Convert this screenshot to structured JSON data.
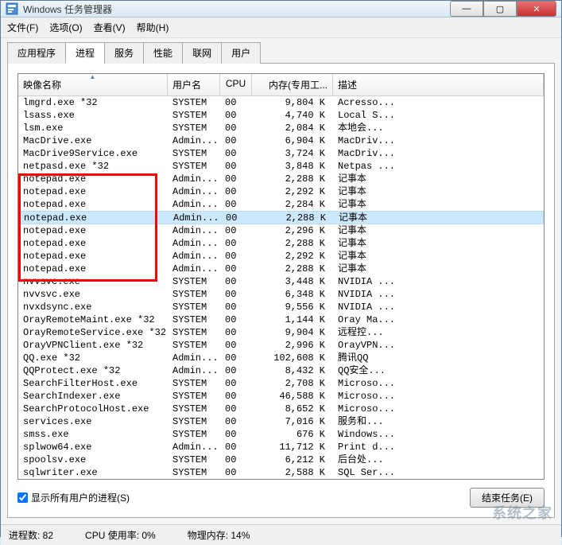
{
  "window": {
    "title": "Windows 任务管理器"
  },
  "menu": {
    "file": "文件(F)",
    "options": "选项(O)",
    "view": "查看(V)",
    "help": "帮助(H)"
  },
  "tabs": [
    "应用程序",
    "进程",
    "服务",
    "性能",
    "联网",
    "用户"
  ],
  "active_tab_index": 1,
  "columns": {
    "image": "映像名称",
    "user": "用户名",
    "cpu": "CPU",
    "mem": "内存(专用工...",
    "desc": "描述"
  },
  "rows": [
    {
      "image": "lmgrd.exe *32",
      "user": "SYSTEM",
      "cpu": "00",
      "mem": "9,804 K",
      "desc": "Acresso..."
    },
    {
      "image": "lsass.exe",
      "user": "SYSTEM",
      "cpu": "00",
      "mem": "4,740 K",
      "desc": "Local S..."
    },
    {
      "image": "lsm.exe",
      "user": "SYSTEM",
      "cpu": "00",
      "mem": "2,084 K",
      "desc": "本地会..."
    },
    {
      "image": "MacDrive.exe",
      "user": "Admin...",
      "cpu": "00",
      "mem": "6,904 K",
      "desc": "MacDriv..."
    },
    {
      "image": "MacDrive9Service.exe",
      "user": "SYSTEM",
      "cpu": "00",
      "mem": "3,724 K",
      "desc": "MacDriv..."
    },
    {
      "image": "netpasd.exe *32",
      "user": "SYSTEM",
      "cpu": "00",
      "mem": "3,848 K",
      "desc": "Netpas ..."
    },
    {
      "image": "notepad.exe",
      "user": "Admin...",
      "cpu": "00",
      "mem": "2,288 K",
      "desc": "记事本"
    },
    {
      "image": "notepad.exe",
      "user": "Admin...",
      "cpu": "00",
      "mem": "2,292 K",
      "desc": "记事本"
    },
    {
      "image": "notepad.exe",
      "user": "Admin...",
      "cpu": "00",
      "mem": "2,284 K",
      "desc": "记事本"
    },
    {
      "image": "notepad.exe",
      "user": "Admin...",
      "cpu": "00",
      "mem": "2,288 K",
      "desc": "记事本",
      "selected": true
    },
    {
      "image": "notepad.exe",
      "user": "Admin...",
      "cpu": "00",
      "mem": "2,296 K",
      "desc": "记事本"
    },
    {
      "image": "notepad.exe",
      "user": "Admin...",
      "cpu": "00",
      "mem": "2,288 K",
      "desc": "记事本"
    },
    {
      "image": "notepad.exe",
      "user": "Admin...",
      "cpu": "00",
      "mem": "2,292 K",
      "desc": "记事本"
    },
    {
      "image": "notepad.exe",
      "user": "Admin...",
      "cpu": "00",
      "mem": "2,288 K",
      "desc": "记事本"
    },
    {
      "image": "nvvsvc.exe",
      "user": "SYSTEM",
      "cpu": "00",
      "mem": "3,448 K",
      "desc": "NVIDIA ..."
    },
    {
      "image": "nvvsvc.exe",
      "user": "SYSTEM",
      "cpu": "00",
      "mem": "6,348 K",
      "desc": "NVIDIA ..."
    },
    {
      "image": "nvxdsync.exe",
      "user": "SYSTEM",
      "cpu": "00",
      "mem": "9,556 K",
      "desc": "NVIDIA ..."
    },
    {
      "image": "OrayRemoteMaint.exe *32",
      "user": "SYSTEM",
      "cpu": "00",
      "mem": "1,144 K",
      "desc": "Oray Ma..."
    },
    {
      "image": "OrayRemoteService.exe *32",
      "user": "SYSTEM",
      "cpu": "00",
      "mem": "9,904 K",
      "desc": "远程控..."
    },
    {
      "image": "OrayVPNClient.exe *32",
      "user": "SYSTEM",
      "cpu": "00",
      "mem": "2,996 K",
      "desc": "OrayVPN..."
    },
    {
      "image": "QQ.exe *32",
      "user": "Admin...",
      "cpu": "00",
      "mem": "102,608 K",
      "desc": "腾讯QQ"
    },
    {
      "image": "QQProtect.exe *32",
      "user": "Admin...",
      "cpu": "00",
      "mem": "8,432 K",
      "desc": "QQ安全..."
    },
    {
      "image": "SearchFilterHost.exe",
      "user": "SYSTEM",
      "cpu": "00",
      "mem": "2,708 K",
      "desc": "Microso..."
    },
    {
      "image": "SearchIndexer.exe",
      "user": "SYSTEM",
      "cpu": "00",
      "mem": "46,588 K",
      "desc": "Microso..."
    },
    {
      "image": "SearchProtocolHost.exe",
      "user": "SYSTEM",
      "cpu": "00",
      "mem": "8,652 K",
      "desc": "Microso..."
    },
    {
      "image": "services.exe",
      "user": "SYSTEM",
      "cpu": "00",
      "mem": "7,016 K",
      "desc": "服务和..."
    },
    {
      "image": "smss.exe",
      "user": "SYSTEM",
      "cpu": "00",
      "mem": "676 K",
      "desc": "Windows..."
    },
    {
      "image": "splwow64.exe",
      "user": "Admin...",
      "cpu": "00",
      "mem": "11,712 K",
      "desc": "Print d..."
    },
    {
      "image": "spoolsv.exe",
      "user": "SYSTEM",
      "cpu": "00",
      "mem": "6,212 K",
      "desc": "后台处..."
    },
    {
      "image": "sqlwriter.exe",
      "user": "SYSTEM",
      "cpu": "00",
      "mem": "2,588 K",
      "desc": "SQL Ser..."
    }
  ],
  "footer": {
    "show_all": "显示所有用户的进程(S)",
    "end_task": "结束任务(E)"
  },
  "status": {
    "processes": "进程数: 82",
    "cpu": "CPU 使用率: 0%",
    "mem": "物理内存: 14%"
  },
  "watermark": "系统之家"
}
